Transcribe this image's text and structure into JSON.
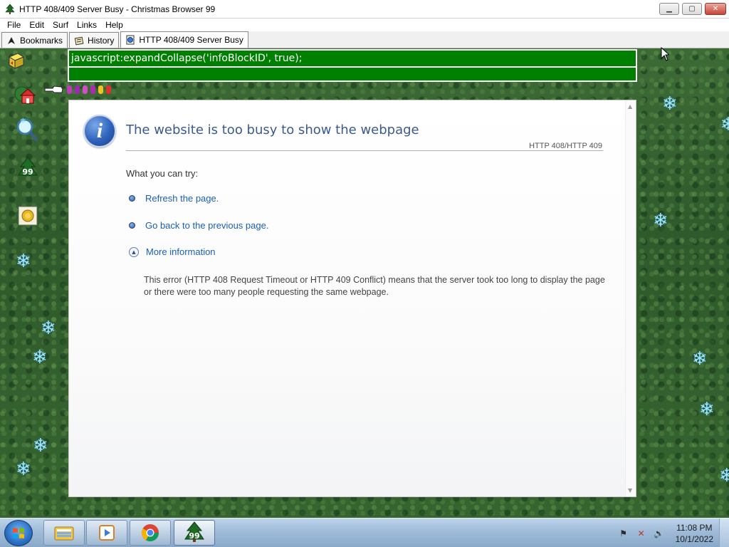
{
  "window": {
    "title": "HTTP 408/409 Server Busy - Christmas Browser 99",
    "controls": [
      "minimize",
      "maximize",
      "close"
    ]
  },
  "menu": [
    "File",
    "Edit",
    "Surf",
    "Links",
    "Help"
  ],
  "tabs": [
    {
      "label": "Bookmarks",
      "icon": "bookmark-arrow-icon"
    },
    {
      "label": "History",
      "icon": "history-scroll-icon"
    },
    {
      "label": "HTTP 408/409 Server Busy",
      "icon": "globe-page-icon",
      "active": true
    }
  ],
  "address_bar": {
    "url": "javascript:expandCollapse('infoBlockID', true);",
    "second_row": ""
  },
  "toolbar_badge": "99",
  "error_page": {
    "heading": "The website is too busy to show the webpage",
    "code": "HTTP 408/HTTP 409",
    "try_label": "What you can try:",
    "actions": [
      "Refresh the page.",
      "Go back to the previous page."
    ],
    "more_info": "More information",
    "description": "This error (HTTP 408 Request Timeout or HTTP 409 Conflict) means that the server took too long to display the page or there were too many people requesting the same webpage."
  },
  "taskbar": {
    "pinned": [
      "windows-explorer-icon",
      "media-player-icon",
      "chrome-icon",
      "christmas-browser-icon"
    ],
    "active_badge": "99",
    "clock_time": "11:08 PM",
    "clock_date": "10/1/2022"
  },
  "colors": {
    "address_bg": "#008000",
    "heading": "#3b5a8c",
    "link": "#1a5fb4",
    "snowflake": "#9be8ff"
  }
}
